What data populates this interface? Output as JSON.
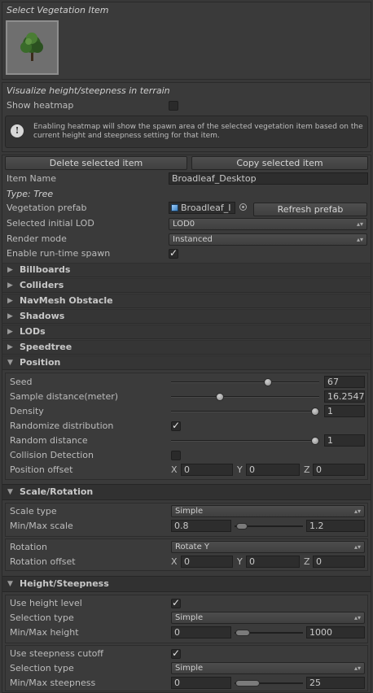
{
  "header": {
    "title": "Select Vegetation Item"
  },
  "visualize": {
    "title": "Visualize height/steepness in terrain",
    "show_heatmap_label": "Show heatmap",
    "show_heatmap": false,
    "info": "Enabling heatmap will show the spawn area of the selected vegetation item based on the current height and steepness setting for that item."
  },
  "actions": {
    "delete_label": "Delete selected item",
    "copy_label": "Copy selected item"
  },
  "item": {
    "name_label": "Item Name",
    "name_value": "Broadleaf_Desktop",
    "type_text": "Type: Tree",
    "prefab_label": "Vegetation prefab",
    "prefab_value": "Broadleaf_I",
    "refresh_label": "Refresh prefab",
    "lod_label": "Selected initial LOD",
    "lod_value": "LOD0",
    "render_label": "Render mode",
    "render_value": "Instanced",
    "runtime_label": "Enable run-time spawn",
    "runtime": true
  },
  "sections": {
    "billboards": "Billboards",
    "colliders": "Colliders",
    "navmesh": "NavMesh Obstacle",
    "shadows": "Shadows",
    "lods": "LODs",
    "speedtree": "Speedtree",
    "position": "Position",
    "scale_rotation": "Scale/Rotation",
    "height_steepness": "Height/Steepness"
  },
  "position": {
    "seed_label": "Seed",
    "seed_value": "67",
    "seed_frac": 0.66,
    "sample_label": "Sample distance(meter)",
    "sample_value": "16.2547",
    "sample_frac": 0.32,
    "density_label": "Density",
    "density_value": "1",
    "density_frac": 1.0,
    "randomize_label": "Randomize distribution",
    "randomize": true,
    "random_distance_label": "Random distance",
    "random_distance_value": "1",
    "random_distance_frac": 1.0,
    "collision_label": "Collision Detection",
    "collision": false,
    "offset_label": "Position offset",
    "x_label": "X",
    "x_value": "0",
    "y_label": "Y",
    "y_value": "0",
    "z_label": "Z",
    "z_value": "0"
  },
  "scale": {
    "type_label": "Scale type",
    "type_value": "Simple",
    "minmax_label": "Min/Max scale",
    "min_value": "0.8",
    "max_value": "1.2",
    "rotation_label": "Rotation",
    "rotation_value": "Rotate Y",
    "rot_offset_label": "Rotation offset",
    "x_label": "X",
    "x_value": "0",
    "y_label": "Y",
    "y_value": "0",
    "z_label": "Z",
    "z_value": "0"
  },
  "height": {
    "use_height_label": "Use height level",
    "use_height": true,
    "sel_type_label": "Selection type",
    "sel_type_value": "Simple",
    "minmax_label": "Min/Max height",
    "min_value": "0",
    "max_value": "1000"
  },
  "steepness": {
    "use_label": "Use steepness cutoff",
    "use": true,
    "sel_type_label": "Selection type",
    "sel_type_value": "Simple",
    "minmax_label": "Min/Max steepness",
    "min_value": "0",
    "max_value": "25"
  },
  "icons": {
    "tree": "tree-icon",
    "prefab": "prefab-cube-icon",
    "info": "info-icon",
    "picker": "object-picker-icon",
    "foldout": "foldout-triangle-icon"
  }
}
